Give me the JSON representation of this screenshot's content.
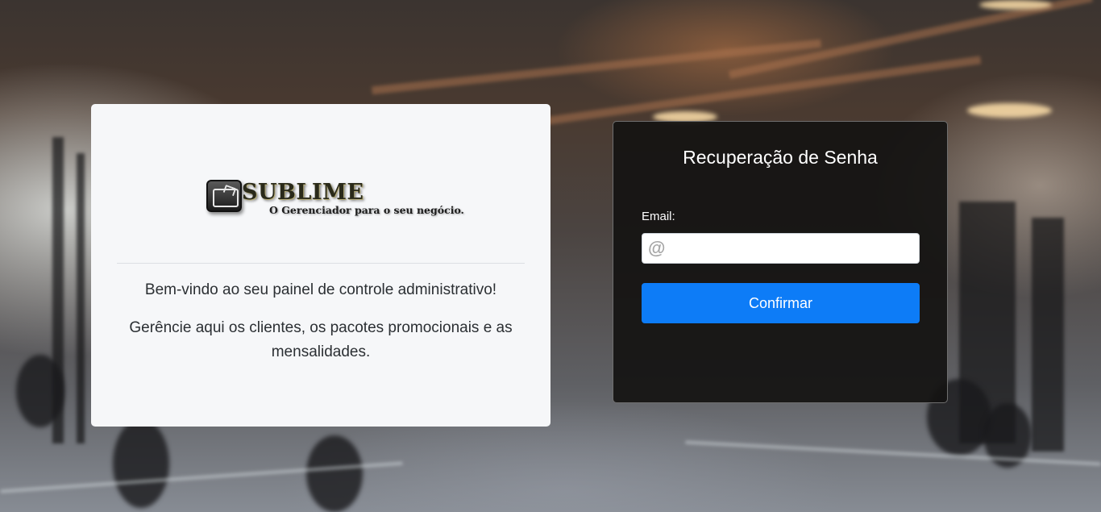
{
  "brand": {
    "name": "SUBLIME",
    "tagline": "O Gerenciador para o seu negócio.",
    "logo_icon": "folder-box-icon"
  },
  "welcome": {
    "line1": "Bem-vindo ao seu painel de controle administrativo!",
    "line2": "Gerêncie aqui os clientes, os pacotes promocionais e as mensalidades."
  },
  "recovery": {
    "title": "Recuperação de Senha",
    "email_label": "Email:",
    "email_placeholder": "@",
    "email_value": "",
    "confirm_label": "Confirmar"
  },
  "colors": {
    "primary_button": "#0d7cf7",
    "card_dark": "#141312",
    "card_light": "#f6f7f9"
  }
}
